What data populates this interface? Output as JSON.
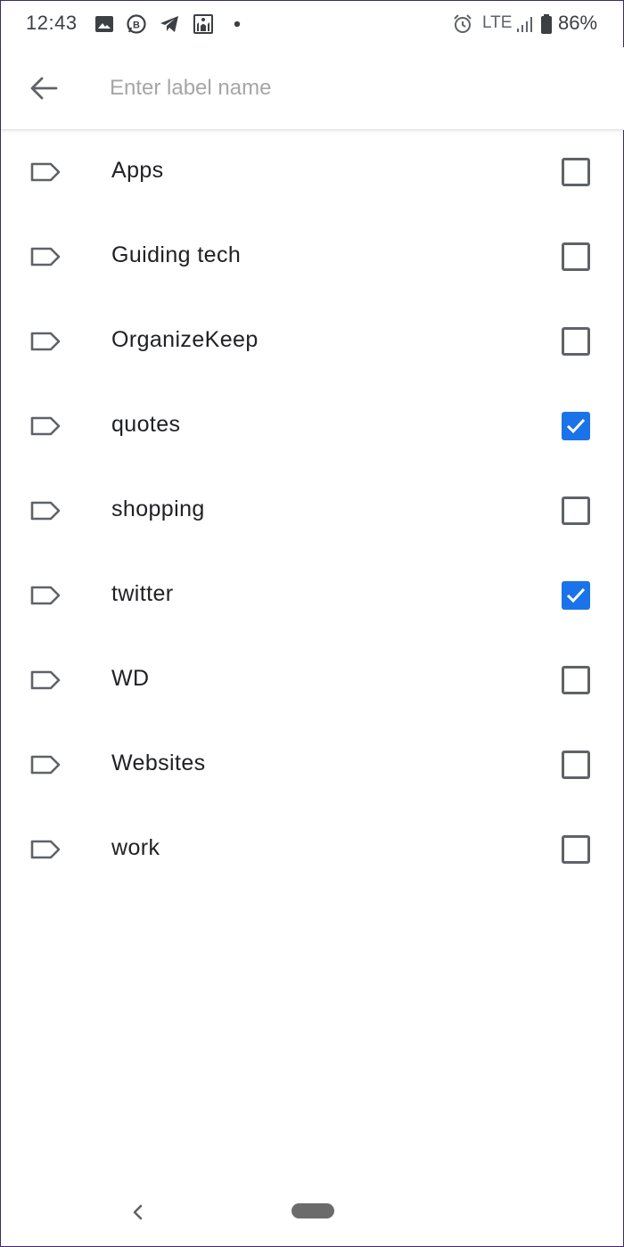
{
  "status_bar": {
    "time": "12:43",
    "network": "LTE",
    "battery": "86%",
    "icons": [
      "gallery-icon",
      "whatsapp-business-icon",
      "telegram-icon",
      "mosque-app-icon",
      "notification-dot-icon",
      "alarm-icon",
      "signal-icon",
      "battery-icon"
    ]
  },
  "toolbar": {
    "input_value": "",
    "input_placeholder": "Enter label name"
  },
  "labels": [
    {
      "name": "Apps",
      "checked": false
    },
    {
      "name": "Guiding tech",
      "checked": false
    },
    {
      "name": "OrganizeKeep",
      "checked": false
    },
    {
      "name": "quotes",
      "checked": true
    },
    {
      "name": "shopping",
      "checked": false
    },
    {
      "name": "twitter",
      "checked": true
    },
    {
      "name": "WD",
      "checked": false
    },
    {
      "name": "Websites",
      "checked": false
    },
    {
      "name": "work",
      "checked": false
    }
  ],
  "colors": {
    "accent": "#1a73e8",
    "icon_gray": "#5f6368",
    "text": "#202124",
    "placeholder": "#a6a6a6"
  }
}
